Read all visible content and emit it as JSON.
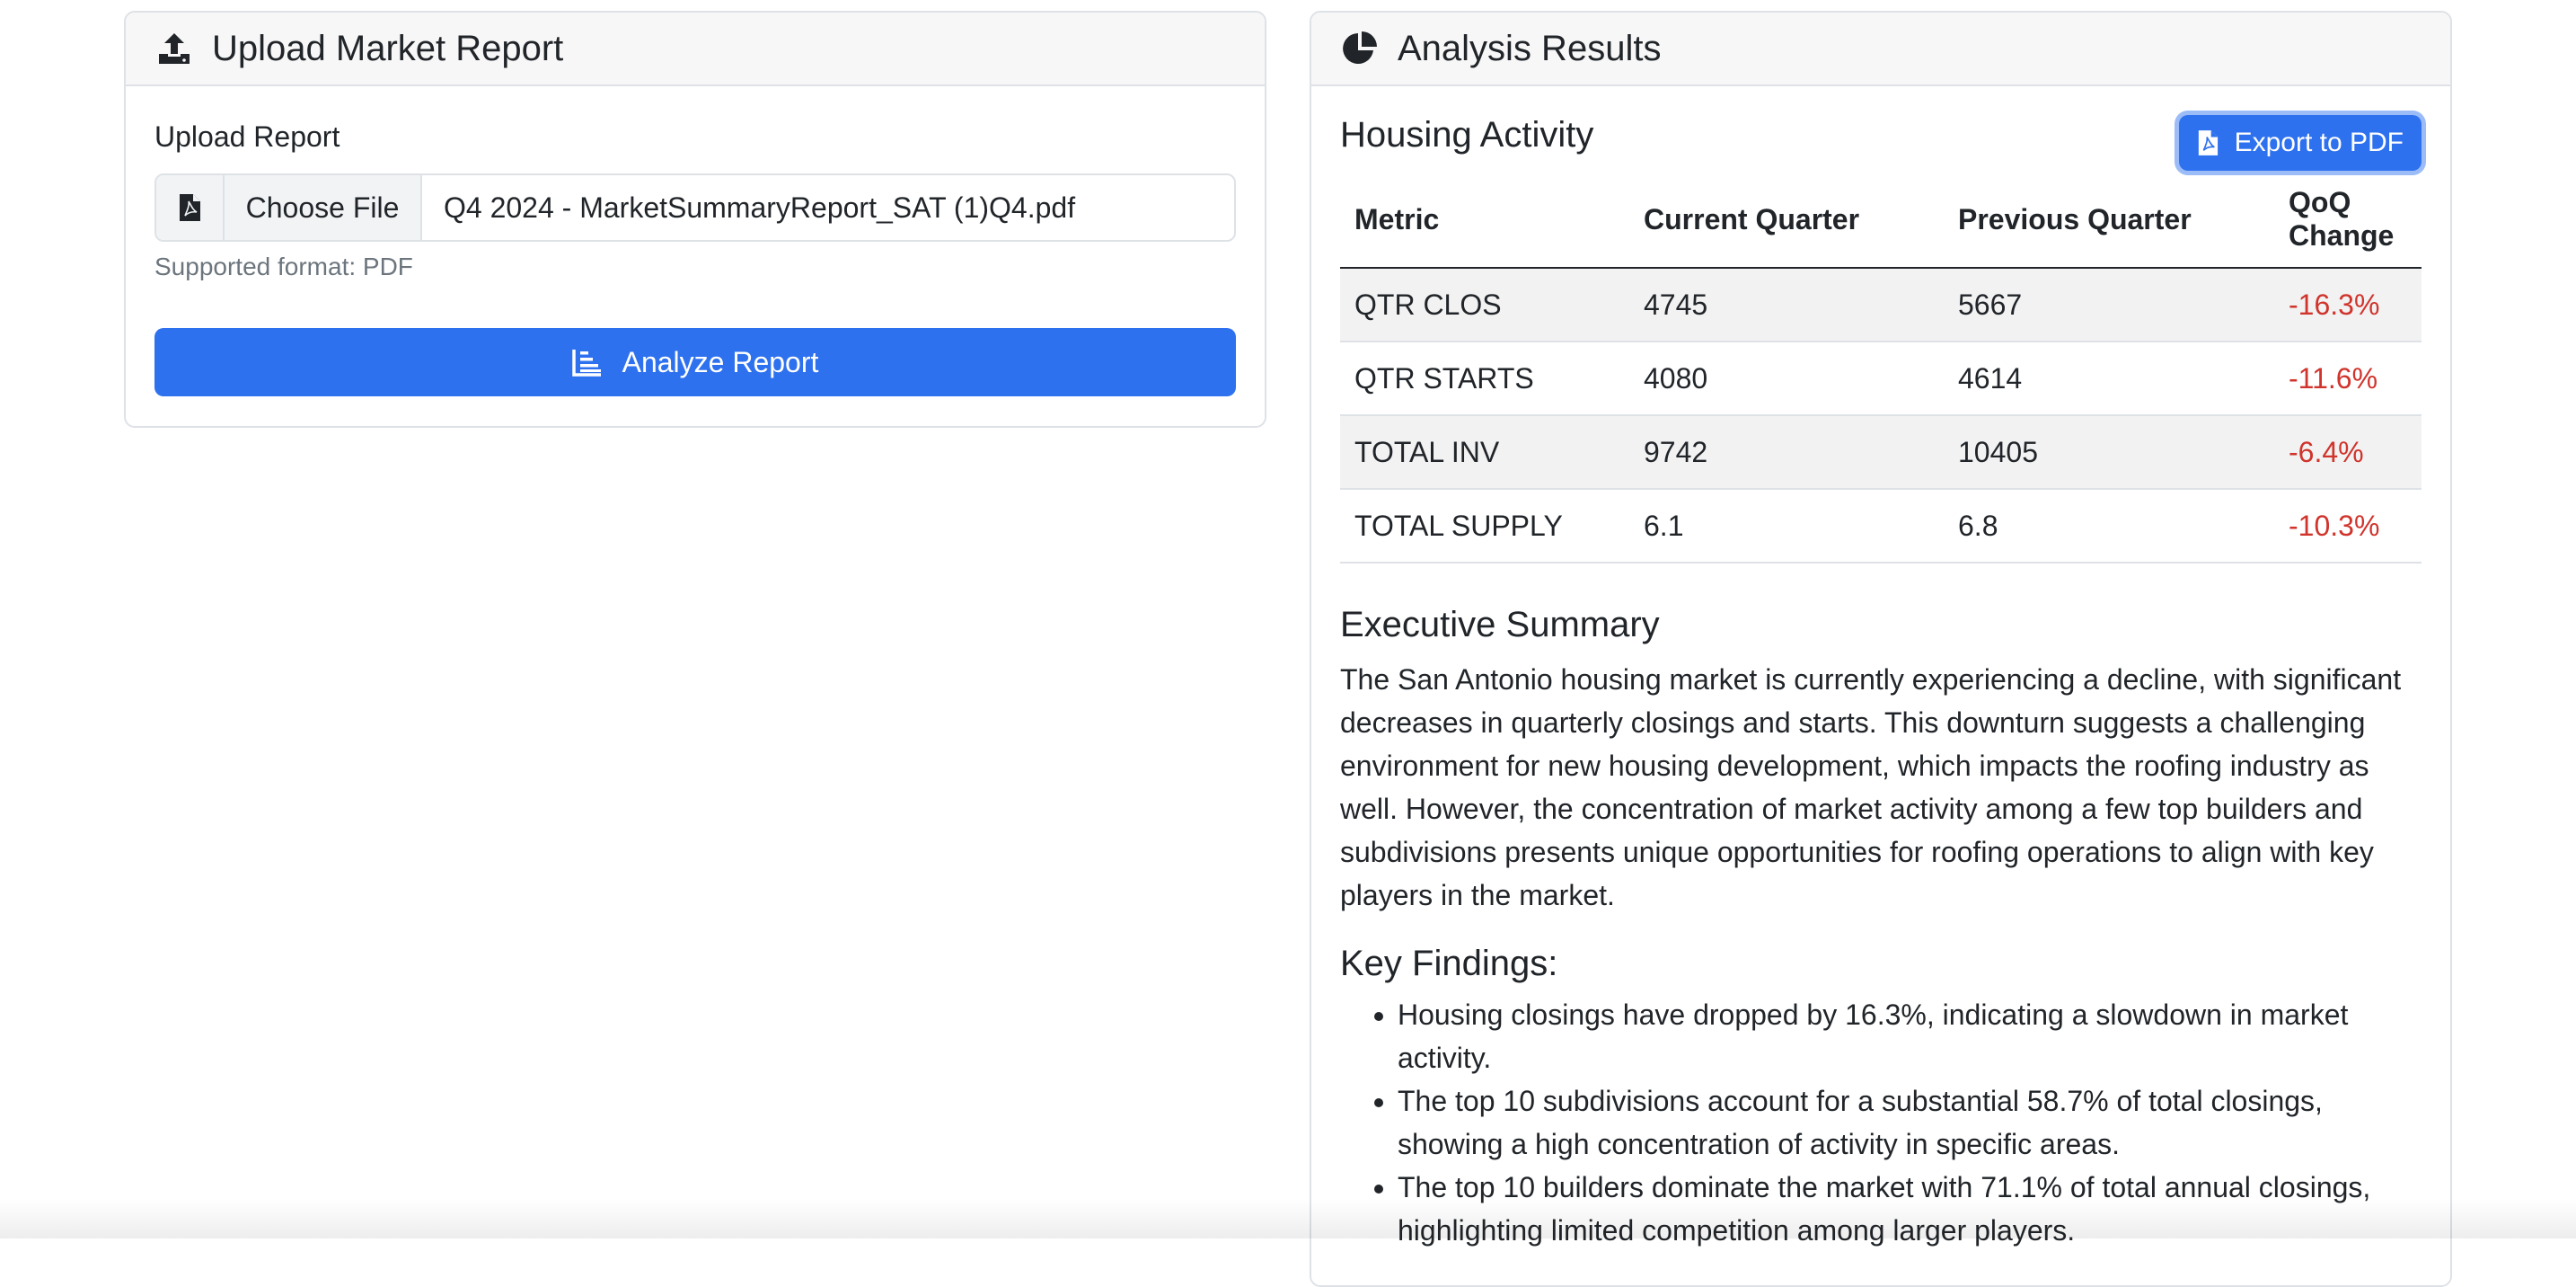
{
  "upload_card": {
    "title": "Upload Market Report",
    "icon": "upload-icon",
    "field_label": "Upload Report",
    "file_icon": "file-pdf-icon",
    "choose_label": "Choose File",
    "file_name": "Q4 2024 - MarketSummaryReport_SAT (1)Q4.pdf",
    "help_text": "Supported format: PDF",
    "analyze_label": "Analyze Report",
    "analyze_icon": "bar-chart-icon"
  },
  "results_card": {
    "title": "Analysis Results",
    "icon": "pie-chart-icon",
    "section_title": "Housing Activity",
    "export_label": "Export to PDF",
    "export_icon": "file-pdf-icon",
    "table": {
      "headers": [
        "Metric",
        "Current Quarter",
        "Previous Quarter",
        "QoQ Change"
      ],
      "rows": [
        [
          "QTR CLOS",
          "4745",
          "5667",
          "-16.3%"
        ],
        [
          "QTR STARTS",
          "4080",
          "4614",
          "-11.6%"
        ],
        [
          "TOTAL INV",
          "9742",
          "10405",
          "-6.4%"
        ],
        [
          "TOTAL SUPPLY",
          "6.1",
          "6.8",
          "-10.3%"
        ]
      ]
    },
    "exec_title": "Executive Summary",
    "exec_text": "The San Antonio housing market is currently experiencing a decline, with significant decreases in quarterly closings and starts. This downturn suggests a challenging environment for new housing development, which impacts the roofing industry as well. However, the concentration of market activity among a few top builders and subdivisions presents unique opportunities for roofing operations to align with key players in the market.",
    "findings_title": "Key Findings:",
    "findings": [
      "Housing closings have dropped by 16.3%, indicating a slowdown in market activity.",
      "The top 10 subdivisions account for a substantial 58.7% of total closings, showing a high concentration of activity in specific areas.",
      "The top 10 builders dominate the market with 71.1% of total annual closings, highlighting limited competition among larger players."
    ]
  },
  "colors": {
    "primary": "#2e71ee",
    "negative": "#d0342c",
    "muted": "#6c757d",
    "header_bg": "#f7f7f7"
  }
}
